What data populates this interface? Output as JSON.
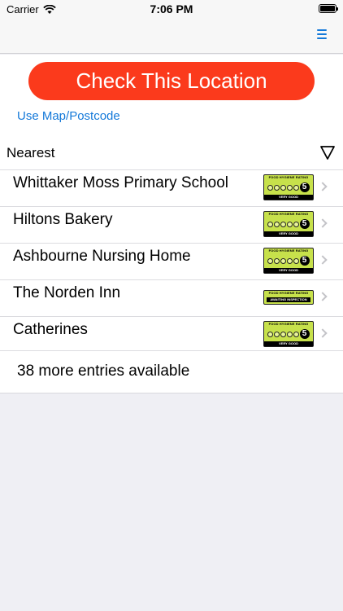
{
  "status_bar": {
    "carrier": "Carrier",
    "time": "7:06 PM"
  },
  "nav": {
    "menu_icon": "hamburger-menu-icon",
    "accent_color": "#1479d9"
  },
  "check_button": {
    "label": "Check This Location",
    "color": "#fb3a1c"
  },
  "map_link": {
    "label": "Use Map/Postcode"
  },
  "sort": {
    "label": "Nearest",
    "icon": "filter-triangle-icon"
  },
  "rating_badge_text": {
    "header": "FOOD HYGIENE RATING",
    "very_good": "VERY GOOD",
    "awaiting": "AWAITING INSPECTION",
    "scale": [
      "0",
      "1",
      "2",
      "3",
      "4",
      "5"
    ]
  },
  "establishments": [
    {
      "name": "Whittaker Moss Primary School",
      "rating": "5",
      "rating_text": "VERY GOOD"
    },
    {
      "name": "Hiltons Bakery",
      "rating": "5",
      "rating_text": "VERY GOOD"
    },
    {
      "name": "Ashbourne Nursing Home",
      "rating": "5",
      "rating_text": "VERY GOOD"
    },
    {
      "name": "The Norden Inn",
      "rating": "awaiting",
      "rating_text": "AWAITING INSPECTION"
    },
    {
      "name": "Catherines",
      "rating": "5",
      "rating_text": "VERY GOOD"
    }
  ],
  "more_entries": {
    "label": "38 more entries available"
  }
}
